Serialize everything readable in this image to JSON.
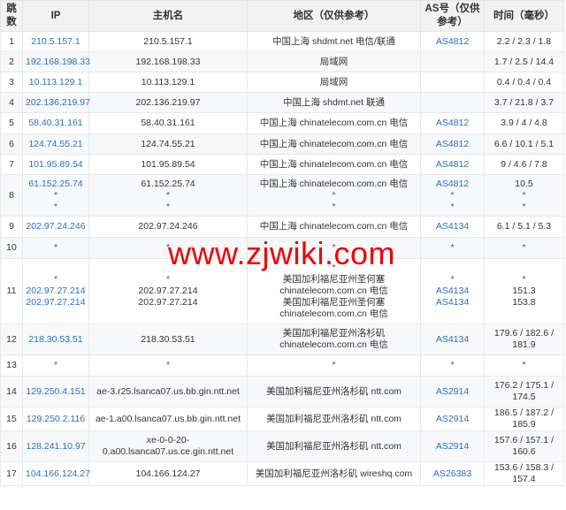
{
  "headers": {
    "hop": "跳数",
    "ip": "IP",
    "host": "主机名",
    "region": "地区（仅供参考）",
    "as": "AS号（仅供参考）",
    "time": "时间（毫秒）"
  },
  "rows": [
    {
      "hop": "1",
      "ip": [
        "210.5.157.1"
      ],
      "host": [
        "210.5.157.1"
      ],
      "region": [
        "中国上海 shdmt.net 电信/联通"
      ],
      "as": [
        "AS4812"
      ],
      "time": [
        "2.2 / 2.3 / 1.8"
      ]
    },
    {
      "hop": "2",
      "ip": [
        "192.168.198.33"
      ],
      "host": [
        "192.168.198.33"
      ],
      "region": [
        "局域网"
      ],
      "as": [],
      "time": [
        "1.7 / 2.5 / 14.4"
      ]
    },
    {
      "hop": "3",
      "ip": [
        "10.113.129.1"
      ],
      "host": [
        "10.113.129.1"
      ],
      "region": [
        "局域网"
      ],
      "as": [],
      "time": [
        "0.4 / 0.4 / 0.4"
      ]
    },
    {
      "hop": "4",
      "ip": [
        "202.136.219.97"
      ],
      "host": [
        "202.136.219.97"
      ],
      "region": [
        "中国上海 shdmt.net 联通"
      ],
      "as": [],
      "time": [
        "3.7 / 21.8 / 3.7"
      ]
    },
    {
      "hop": "5",
      "ip": [
        "58.40.31.161"
      ],
      "host": [
        "58.40.31.161"
      ],
      "region": [
        "中国上海 chinatelecom.com.cn 电信"
      ],
      "as": [
        "AS4812"
      ],
      "time": [
        "3.9 / 4 / 4.8"
      ]
    },
    {
      "hop": "6",
      "ip": [
        "124.74.55.21"
      ],
      "host": [
        "124.74.55.21"
      ],
      "region": [
        "中国上海 chinatelecom.com.cn 电信"
      ],
      "as": [
        "AS4812"
      ],
      "time": [
        "6.6 / 10.1 / 5.1"
      ]
    },
    {
      "hop": "7",
      "ip": [
        "101.95.89.54"
      ],
      "host": [
        "101.95.89.54"
      ],
      "region": [
        "中国上海 chinatelecom.com.cn 电信"
      ],
      "as": [
        "AS4812"
      ],
      "time": [
        "9 / 4.6 / 7.8"
      ]
    },
    {
      "hop": "8",
      "ip": [
        "61.152.25.74",
        "*",
        "*"
      ],
      "host": [
        "61.152.25.74",
        "*",
        "*"
      ],
      "region": [
        "中国上海 chinatelecom.com.cn 电信",
        "*",
        "*"
      ],
      "as": [
        "AS4812",
        "*",
        "*"
      ],
      "time": [
        "10.5",
        "*",
        "*"
      ]
    },
    {
      "hop": "9",
      "ip": [
        "202.97.24.246"
      ],
      "host": [
        "202.97.24.246"
      ],
      "region": [
        "中国上海 chinatelecom.com.cn 电信"
      ],
      "as": [
        "AS4134"
      ],
      "time": [
        "6.1 / 5.1 / 5.3"
      ]
    },
    {
      "hop": "10",
      "ip": [
        "*"
      ],
      "host": [
        "*"
      ],
      "region": [
        "*"
      ],
      "as": [
        "*"
      ],
      "time": [
        "*"
      ]
    },
    {
      "hop": "11",
      "ip": [
        "*",
        "202.97.27.214",
        "202.97.27.214"
      ],
      "host": [
        "*",
        "202.97.27.214",
        "202.97.27.214"
      ],
      "region": [
        "*",
        "美国加利福尼亚州圣何塞",
        "chinatelecom.com.cn 电信",
        "美国加利福尼亚州圣何塞",
        "chinatelecom.com.cn 电信"
      ],
      "as": [
        "*",
        "AS4134",
        "AS4134"
      ],
      "time": [
        "*",
        "151.3",
        "153.8"
      ]
    },
    {
      "hop": "12",
      "ip": [
        "218.30.53.51"
      ],
      "host": [
        "218.30.53.51"
      ],
      "region": [
        "美国加利福尼亚州洛杉矶",
        "chinatelecom.com.cn 电信"
      ],
      "as": [
        "AS4134"
      ],
      "time": [
        "179.6 / 182.6 /",
        "181.9"
      ]
    },
    {
      "hop": "13",
      "ip": [
        "*"
      ],
      "host": [
        "*"
      ],
      "region": [
        "*"
      ],
      "as": [
        "*"
      ],
      "time": [
        "*"
      ]
    },
    {
      "hop": "14",
      "ip": [
        "129.250.4.151"
      ],
      "host": [
        "ae-3.r25.lsanca07.us.bb.gin.ntt.net"
      ],
      "region": [
        "美国加利福尼亚州洛杉矶 ntt.com"
      ],
      "as": [
        "AS2914"
      ],
      "time": [
        "176.2 / 175.1 /",
        "174.5"
      ]
    },
    {
      "hop": "15",
      "ip": [
        "129.250.2.116"
      ],
      "host": [
        "ae-1.a00.lsanca07.us.bb.gin.ntt.net"
      ],
      "region": [
        "美国加利福尼亚州洛杉矶 ntt.com"
      ],
      "as": [
        "AS2914"
      ],
      "time": [
        "186.5 / 187.2 /",
        "185.9"
      ]
    },
    {
      "hop": "16",
      "ip": [
        "128.241.10.97"
      ],
      "host": [
        "xe-0-0-20-",
        "0.a00.lsanca07.us.ce.gin.ntt.net"
      ],
      "region": [
        "美国加利福尼亚州洛杉矶 ntt.com"
      ],
      "as": [
        "AS2914"
      ],
      "time": [
        "157.6 / 157.1 /",
        "160.6"
      ]
    },
    {
      "hop": "17",
      "ip": [
        "104.166.124.27"
      ],
      "host": [
        "104.166.124.27"
      ],
      "region": [
        "美国加利福尼亚州洛杉矶 wireshq.com"
      ],
      "as": [
        "AS26383"
      ],
      "time": [
        "153.6 / 158.3 /",
        "157.4"
      ]
    }
  ],
  "watermark": "www.zjwiki.com",
  "colors": {
    "link": "#2a6fc2",
    "watermark": "#f20000",
    "header_bg": "#f2f2f2",
    "stripe": "#f7f8fa"
  }
}
